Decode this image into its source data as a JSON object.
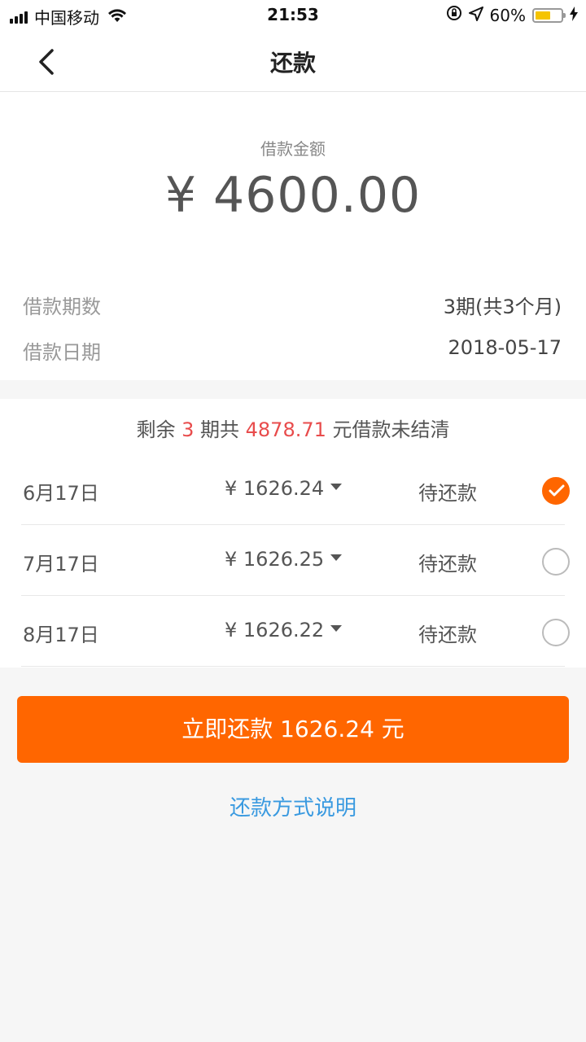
{
  "status_bar": {
    "carrier": "中国移动",
    "time": "21:53",
    "battery_percent": "60%",
    "battery_level": 0.6,
    "icons": [
      "signal-icon",
      "wifi-icon",
      "orientation-lock-icon",
      "location-icon",
      "battery-icon",
      "charging-icon"
    ]
  },
  "nav": {
    "title": "还款",
    "back_icon": "chevron-left-icon"
  },
  "loan": {
    "amount_label": "借款金额",
    "amount": "¥ 4600.00",
    "rows": [
      {
        "label": "借款期数",
        "value": "3期(共3个月)"
      },
      {
        "label": "借款日期",
        "value": "2018-05-17"
      }
    ]
  },
  "remaining": {
    "prefix": "剩余 ",
    "periods": "3",
    "middle": " 期共 ",
    "amount": "4878.71",
    "suffix": " 元借款未结清",
    "highlight_color": "#e84c4c"
  },
  "installments": [
    {
      "date": "6月17日",
      "amount": "¥ 1626.24",
      "status": "待还款",
      "selected": true
    },
    {
      "date": "7月17日",
      "amount": "¥ 1626.25",
      "status": "待还款",
      "selected": false
    },
    {
      "date": "8月17日",
      "amount": "¥ 1626.22",
      "status": "待还款",
      "selected": false
    }
  ],
  "actions": {
    "pay_button": "立即还款 1626.24 元",
    "method_link": "还款方式说明",
    "accent_color": "#ff6600",
    "link_color": "#3a9ae0"
  }
}
